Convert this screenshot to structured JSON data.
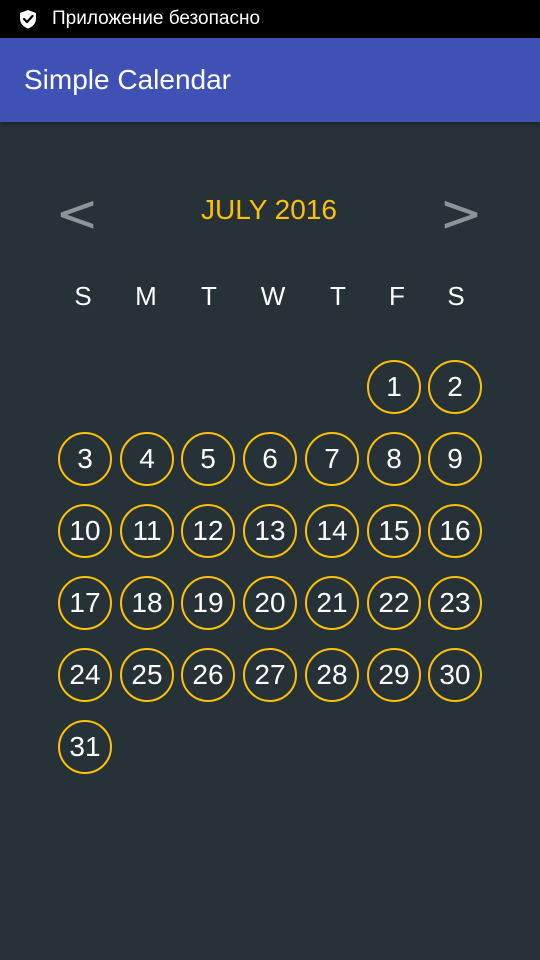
{
  "status_bar": {
    "icon": "shield-check-icon",
    "text": "Приложение безопасно"
  },
  "app_bar": {
    "title": "Simple Calendar",
    "color": "#3f51b5"
  },
  "calendar": {
    "prev_label": "<",
    "next_label": ">",
    "month_label": "JULY 2016",
    "accent_color": "#ffc107",
    "weekdays": [
      "S",
      "M",
      "T",
      "W",
      "T",
      "F",
      "S"
    ],
    "first_weekday_index": 5,
    "days": [
      "1",
      "2",
      "3",
      "4",
      "5",
      "6",
      "7",
      "8",
      "9",
      "10",
      "11",
      "12",
      "13",
      "14",
      "15",
      "16",
      "17",
      "18",
      "19",
      "20",
      "21",
      "22",
      "23",
      "24",
      "25",
      "26",
      "27",
      "28",
      "29",
      "30",
      "31"
    ]
  }
}
